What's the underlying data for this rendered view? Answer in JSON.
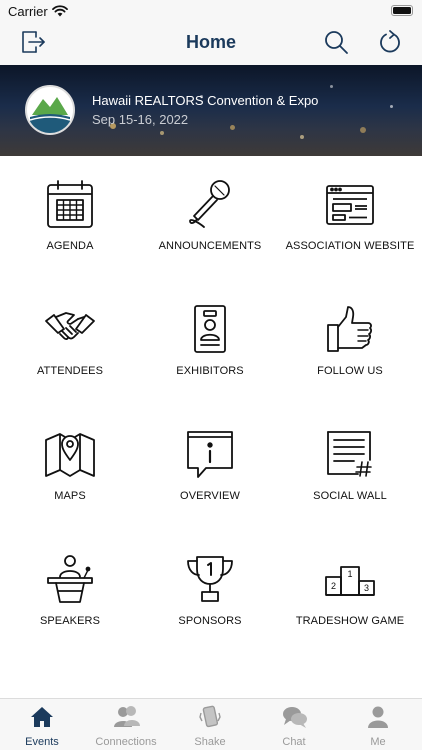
{
  "status_bar": {
    "carrier": "Carrier",
    "wifi_icon": "wifi-icon",
    "battery_icon": "battery-icon",
    "battery_level": 1.0
  },
  "nav": {
    "title": "Home",
    "left_icon": "logout-icon",
    "right_icons": [
      "search-icon",
      "refresh-icon"
    ]
  },
  "banner": {
    "title": "Hawaii REALTORS Convention & Expo",
    "date": "Sep 15-16, 2022",
    "logo_icon": "mountain-logo"
  },
  "grid": {
    "items": [
      {
        "label": "AGENDA",
        "icon": "calendar-icon"
      },
      {
        "label": "ANNOUNCEMENTS",
        "icon": "microphone-icon"
      },
      {
        "label": "ASSOCIATION WEBSITE",
        "icon": "browser-window-icon"
      },
      {
        "label": "ATTENDEES",
        "icon": "handshake-icon"
      },
      {
        "label": "EXHIBITORS",
        "icon": "id-badge-icon"
      },
      {
        "label": "FOLLOW US",
        "icon": "thumbs-up-icon"
      },
      {
        "label": "MAPS",
        "icon": "map-pin-icon"
      },
      {
        "label": "OVERVIEW",
        "icon": "info-icon"
      },
      {
        "label": "SOCIAL WALL",
        "icon": "document-hashtag-icon"
      },
      {
        "label": "SPEAKERS",
        "icon": "podium-icon"
      },
      {
        "label": "SPONSORS",
        "icon": "trophy-icon"
      },
      {
        "label": "TRADESHOW GAME",
        "icon": "winners-podium-icon"
      }
    ]
  },
  "tabs": [
    {
      "label": "Events",
      "icon": "home-icon",
      "active": true
    },
    {
      "label": "Connections",
      "icon": "people-icon",
      "active": false
    },
    {
      "label": "Shake",
      "icon": "phone-shake-icon",
      "active": false
    },
    {
      "label": "Chat",
      "icon": "chat-bubbles-icon",
      "active": false
    },
    {
      "label": "Me",
      "icon": "person-icon",
      "active": false
    }
  ],
  "colors": {
    "nav_title": "#1b3a5c",
    "tab_active": "#1b3a5c",
    "tab_inactive": "#9a9a9a",
    "bar_background": "#f7f7f7"
  }
}
